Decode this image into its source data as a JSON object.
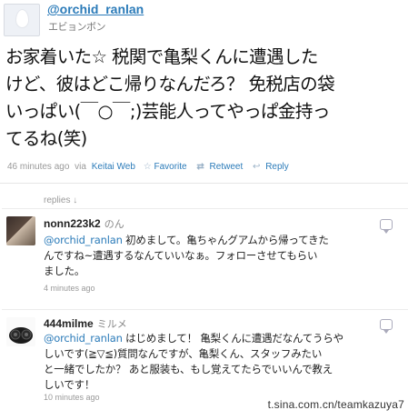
{
  "tweet": {
    "username": "@orchid_ranlan",
    "fullname": "エビョンボン",
    "text_lines": [
      "お家着いた☆ 税関で亀梨くんに遭遇した",
      "けど、彼はどこ帰りなんだろ？ 免税店の袋",
      "いっぱい(￣○￣;)芸能人ってやっぱ金持っ",
      "てるね(笑)"
    ],
    "time": "46 minutes ago",
    "via_prefix": "via",
    "via": "Keitai Web",
    "favorite_label": "Favorite",
    "retweet_label": "Retweet",
    "reply_label": "Reply"
  },
  "replies_label": "replies ↓",
  "replies": [
    {
      "username": "nonn223k2",
      "fullname": "のん",
      "mention": "@orchid_ranlan",
      "first_line_rest": " 初めまして。亀ちゃんグアムから帰ってきた",
      "lines": [
        "んですね~遭遇するなんていいなぁ。フォローさせてもらい",
        "ました。"
      ],
      "time": "4 minutes ago"
    },
    {
      "username": "444milme",
      "fullname": "ミルメ",
      "mention": "@orchid_ranlan",
      "first_line_rest": " はじめまして！ 亀梨くんに遭遇だなんてうらや",
      "lines": [
        "しいです(≧▽≦)質問なんですが、亀梨くん、スタッフみたい",
        "と一緒でしたか？ あと服装も、もし覚えてたらでいいんで教え",
        "しいです！"
      ],
      "time": "10 minutes ago"
    }
  ],
  "watermark": "t.sina.com.cn/teamkazuya7",
  "icons": {
    "favorite": "star-icon",
    "retweet": "retweet-icon",
    "reply": "reply-arrow-icon",
    "reply_bubble": "speech-bubble-icon"
  },
  "colors": {
    "link": "#2b7bb9",
    "meta": "#999999",
    "text": "#111111"
  }
}
